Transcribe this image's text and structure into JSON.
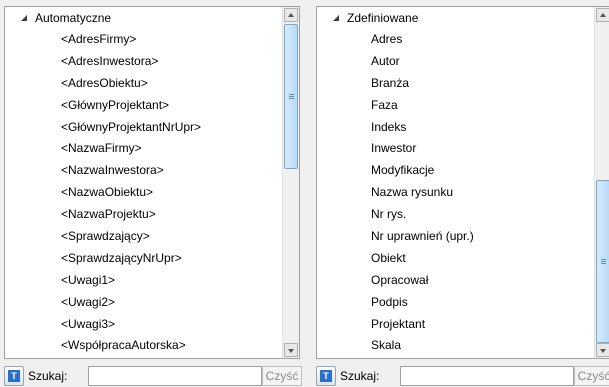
{
  "left_panel": {
    "root_label": "Automatyczne",
    "items": [
      "<AdresFirmy>",
      "<AdresInwestora>",
      "<AdresObiektu>",
      "<GłównyProjektant>",
      "<GłównyProjektantNrUpr>",
      "<NazwaFirmy>",
      "<NazwaInwestora>",
      "<NazwaObiektu>",
      "<NazwaProjektu>",
      "<Sprawdzający>",
      "<SprawdzającyNrUpr>",
      "<Uwagi1>",
      "<Uwagi2>",
      "<Uwagi3>",
      "<WspółpracaAutorska>"
    ],
    "search_label": "Szukaj:",
    "search_value": "",
    "clear_label": "Czyść"
  },
  "right_panel": {
    "root_label": "Zdefiniowane",
    "items": [
      "Adres",
      "Autor",
      "Branża",
      "Faza",
      "Indeks",
      "Inwestor",
      "Modyfikacje",
      "Nazwa rysunku",
      "Nr rys.",
      "Nr uprawnień (upr.)",
      "Obiekt",
      "Opracował",
      "Podpis",
      "Projektant",
      "Skala"
    ],
    "search_label": "Szukaj:",
    "search_value": "",
    "clear_label": "Czyść"
  },
  "icons": {
    "expand": "triangle-expanded-icon",
    "filter": "filter-icon",
    "scroll_up": "scroll-up-arrow-icon",
    "scroll_down": "scroll-down-arrow-icon"
  },
  "colors": {
    "panel_bg": "#ffffff",
    "window_bg": "#f0f0f0",
    "scroll_thumb": "#b7d9f4",
    "filter_icon": "#2a6fc8"
  }
}
